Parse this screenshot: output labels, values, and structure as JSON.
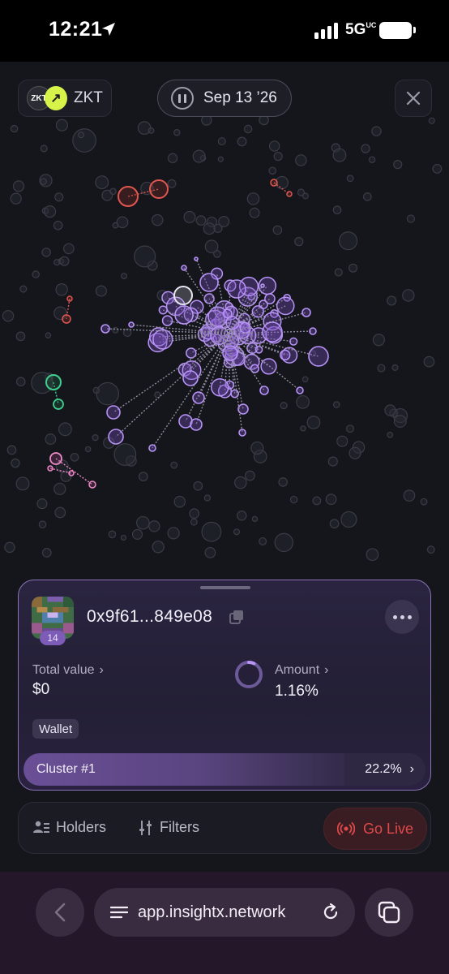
{
  "status_bar": {
    "time": "12:21",
    "network": "5G",
    "network_suffix": "UC"
  },
  "header": {
    "token_symbol": "ZKT",
    "token_logo_text": "ZKT",
    "date": "Sep 13 ’26"
  },
  "graph": {
    "cluster_color": "#b794f6",
    "cluster_red_color": "#e0574f",
    "cluster_green_color": "#3fcf8e",
    "cluster_pink_color": "#f08ac8",
    "background_node_color": "#3a3b46"
  },
  "wallet_card": {
    "address": "0x9f61...849e08",
    "avatar_badge": "14",
    "total_value_label": "Total value",
    "total_value": "$0",
    "amount_label": "Amount",
    "amount": "1.16%",
    "amount_fraction": 0.0116,
    "type_tag": "Wallet",
    "cluster_label": "Cluster #1",
    "cluster_pct": "22.2%",
    "cluster_fraction": 0.222
  },
  "bottom_bar": {
    "holders_label": "Holders",
    "filters_label": "Filters",
    "go_live_label": "Go Live",
    "go_live_color": "#e0484a"
  },
  "browser": {
    "url": "app.insightx.network"
  }
}
